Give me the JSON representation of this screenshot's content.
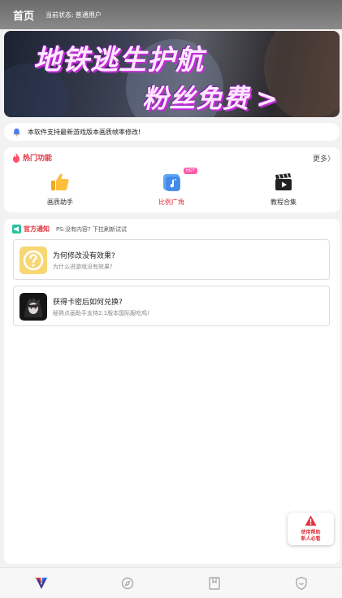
{
  "header": {
    "title": "首页",
    "status_label": "当前状态:",
    "status_value": "普通用户"
  },
  "banner": {
    "line1": "地铁逃生护航",
    "line2": "粉丝免费",
    "arrow": ">"
  },
  "notice_bar": {
    "icon": "bell-icon",
    "text": "本软件支持最新游戏版本画质帧率修改!"
  },
  "hot_features": {
    "title": "热门功能",
    "more": "更多〉",
    "items": [
      {
        "label": "画质助手",
        "icon": "thumbs-up-icon",
        "color": "#333333"
      },
      {
        "label": "比例广角",
        "icon": "music-note-icon",
        "color": "#e0343f",
        "badge": "HOT"
      },
      {
        "label": "教程合集",
        "icon": "video-clapper-icon",
        "color": "#333333"
      }
    ]
  },
  "official_notice": {
    "title": "官方通知",
    "subtitle": "PS:没有内容? 下拉刷新试试",
    "items": [
      {
        "title": "为何修改没有效果?",
        "desc": "为什么进游戏没有效果?",
        "icon": "question-icon"
      },
      {
        "title": "获得卡密后如何兑换?",
        "desc": "秘熟点画助手支持2.1版本国际服吃鸡!",
        "icon": "anime-avatar-icon"
      }
    ]
  },
  "help_button": {
    "line1": "使用帮助",
    "line2": "新人必看",
    "icon": "warning-icon"
  },
  "tabbar": {
    "items": [
      {
        "name": "home-tab",
        "icon": "logo-icon",
        "active": true
      },
      {
        "name": "discover-tab",
        "icon": "compass-icon",
        "active": false
      },
      {
        "name": "bookmark-tab",
        "icon": "bookmark-icon",
        "active": false
      },
      {
        "name": "profile-tab",
        "icon": "shield-icon",
        "active": false
      }
    ]
  },
  "colors": {
    "accent": "#e0343f",
    "hot_badge": "#ff5aa5",
    "banner_text": "#ffe8ff"
  }
}
